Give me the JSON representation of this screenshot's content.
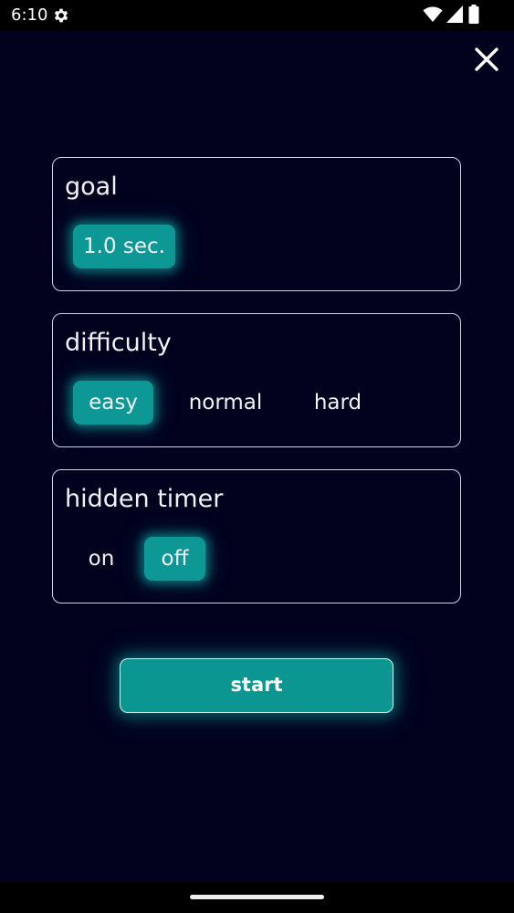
{
  "status_bar": {
    "time": "6:10",
    "icons": [
      "gear-icon",
      "wifi-icon",
      "signal-icon",
      "battery-icon"
    ]
  },
  "header": {
    "close_icon": "close-icon"
  },
  "goal": {
    "title": "goal",
    "options": [
      {
        "label": "1.0 sec.",
        "selected": true
      }
    ]
  },
  "difficulty": {
    "title": "difficulty",
    "options": [
      {
        "label": "easy",
        "selected": true
      },
      {
        "label": "normal",
        "selected": false
      },
      {
        "label": "hard",
        "selected": false
      }
    ]
  },
  "hidden_timer": {
    "title": "hidden timer",
    "options": [
      {
        "label": "on",
        "selected": false
      },
      {
        "label": "off",
        "selected": true
      }
    ]
  },
  "start_button": {
    "label": "start"
  },
  "colors": {
    "background": "#02021f",
    "accent": "#0d9896",
    "card_border": "#cfd3e6",
    "text": "#f2f2f8"
  }
}
